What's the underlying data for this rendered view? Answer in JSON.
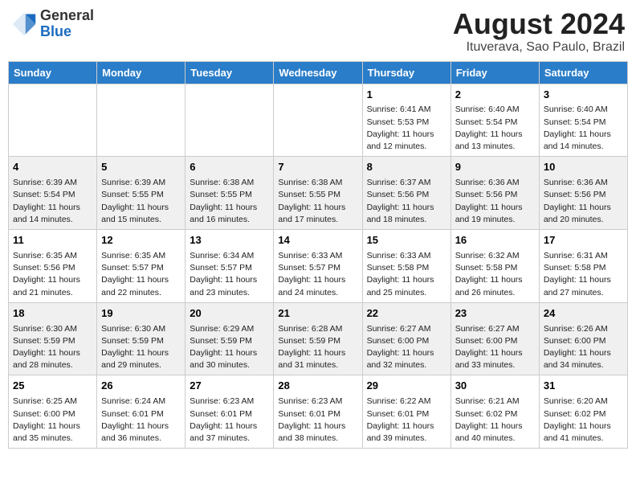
{
  "header": {
    "logo_general": "General",
    "logo_blue": "Blue",
    "month_title": "August 2024",
    "location": "Ituverava, Sao Paulo, Brazil"
  },
  "weekdays": [
    "Sunday",
    "Monday",
    "Tuesday",
    "Wednesday",
    "Thursday",
    "Friday",
    "Saturday"
  ],
  "weeks": [
    [
      {
        "day": "",
        "info": ""
      },
      {
        "day": "",
        "info": ""
      },
      {
        "day": "",
        "info": ""
      },
      {
        "day": "",
        "info": ""
      },
      {
        "day": "1",
        "info": "Sunrise: 6:41 AM\nSunset: 5:53 PM\nDaylight: 11 hours\nand 12 minutes."
      },
      {
        "day": "2",
        "info": "Sunrise: 6:40 AM\nSunset: 5:54 PM\nDaylight: 11 hours\nand 13 minutes."
      },
      {
        "day": "3",
        "info": "Sunrise: 6:40 AM\nSunset: 5:54 PM\nDaylight: 11 hours\nand 14 minutes."
      }
    ],
    [
      {
        "day": "4",
        "info": "Sunrise: 6:39 AM\nSunset: 5:54 PM\nDaylight: 11 hours\nand 14 minutes."
      },
      {
        "day": "5",
        "info": "Sunrise: 6:39 AM\nSunset: 5:55 PM\nDaylight: 11 hours\nand 15 minutes."
      },
      {
        "day": "6",
        "info": "Sunrise: 6:38 AM\nSunset: 5:55 PM\nDaylight: 11 hours\nand 16 minutes."
      },
      {
        "day": "7",
        "info": "Sunrise: 6:38 AM\nSunset: 5:55 PM\nDaylight: 11 hours\nand 17 minutes."
      },
      {
        "day": "8",
        "info": "Sunrise: 6:37 AM\nSunset: 5:56 PM\nDaylight: 11 hours\nand 18 minutes."
      },
      {
        "day": "9",
        "info": "Sunrise: 6:36 AM\nSunset: 5:56 PM\nDaylight: 11 hours\nand 19 minutes."
      },
      {
        "day": "10",
        "info": "Sunrise: 6:36 AM\nSunset: 5:56 PM\nDaylight: 11 hours\nand 20 minutes."
      }
    ],
    [
      {
        "day": "11",
        "info": "Sunrise: 6:35 AM\nSunset: 5:56 PM\nDaylight: 11 hours\nand 21 minutes."
      },
      {
        "day": "12",
        "info": "Sunrise: 6:35 AM\nSunset: 5:57 PM\nDaylight: 11 hours\nand 22 minutes."
      },
      {
        "day": "13",
        "info": "Sunrise: 6:34 AM\nSunset: 5:57 PM\nDaylight: 11 hours\nand 23 minutes."
      },
      {
        "day": "14",
        "info": "Sunrise: 6:33 AM\nSunset: 5:57 PM\nDaylight: 11 hours\nand 24 minutes."
      },
      {
        "day": "15",
        "info": "Sunrise: 6:33 AM\nSunset: 5:58 PM\nDaylight: 11 hours\nand 25 minutes."
      },
      {
        "day": "16",
        "info": "Sunrise: 6:32 AM\nSunset: 5:58 PM\nDaylight: 11 hours\nand 26 minutes."
      },
      {
        "day": "17",
        "info": "Sunrise: 6:31 AM\nSunset: 5:58 PM\nDaylight: 11 hours\nand 27 minutes."
      }
    ],
    [
      {
        "day": "18",
        "info": "Sunrise: 6:30 AM\nSunset: 5:59 PM\nDaylight: 11 hours\nand 28 minutes."
      },
      {
        "day": "19",
        "info": "Sunrise: 6:30 AM\nSunset: 5:59 PM\nDaylight: 11 hours\nand 29 minutes."
      },
      {
        "day": "20",
        "info": "Sunrise: 6:29 AM\nSunset: 5:59 PM\nDaylight: 11 hours\nand 30 minutes."
      },
      {
        "day": "21",
        "info": "Sunrise: 6:28 AM\nSunset: 5:59 PM\nDaylight: 11 hours\nand 31 minutes."
      },
      {
        "day": "22",
        "info": "Sunrise: 6:27 AM\nSunset: 6:00 PM\nDaylight: 11 hours\nand 32 minutes."
      },
      {
        "day": "23",
        "info": "Sunrise: 6:27 AM\nSunset: 6:00 PM\nDaylight: 11 hours\nand 33 minutes."
      },
      {
        "day": "24",
        "info": "Sunrise: 6:26 AM\nSunset: 6:00 PM\nDaylight: 11 hours\nand 34 minutes."
      }
    ],
    [
      {
        "day": "25",
        "info": "Sunrise: 6:25 AM\nSunset: 6:00 PM\nDaylight: 11 hours\nand 35 minutes."
      },
      {
        "day": "26",
        "info": "Sunrise: 6:24 AM\nSunset: 6:01 PM\nDaylight: 11 hours\nand 36 minutes."
      },
      {
        "day": "27",
        "info": "Sunrise: 6:23 AM\nSunset: 6:01 PM\nDaylight: 11 hours\nand 37 minutes."
      },
      {
        "day": "28",
        "info": "Sunrise: 6:23 AM\nSunset: 6:01 PM\nDaylight: 11 hours\nand 38 minutes."
      },
      {
        "day": "29",
        "info": "Sunrise: 6:22 AM\nSunset: 6:01 PM\nDaylight: 11 hours\nand 39 minutes."
      },
      {
        "day": "30",
        "info": "Sunrise: 6:21 AM\nSunset: 6:02 PM\nDaylight: 11 hours\nand 40 minutes."
      },
      {
        "day": "31",
        "info": "Sunrise: 6:20 AM\nSunset: 6:02 PM\nDaylight: 11 hours\nand 41 minutes."
      }
    ]
  ]
}
